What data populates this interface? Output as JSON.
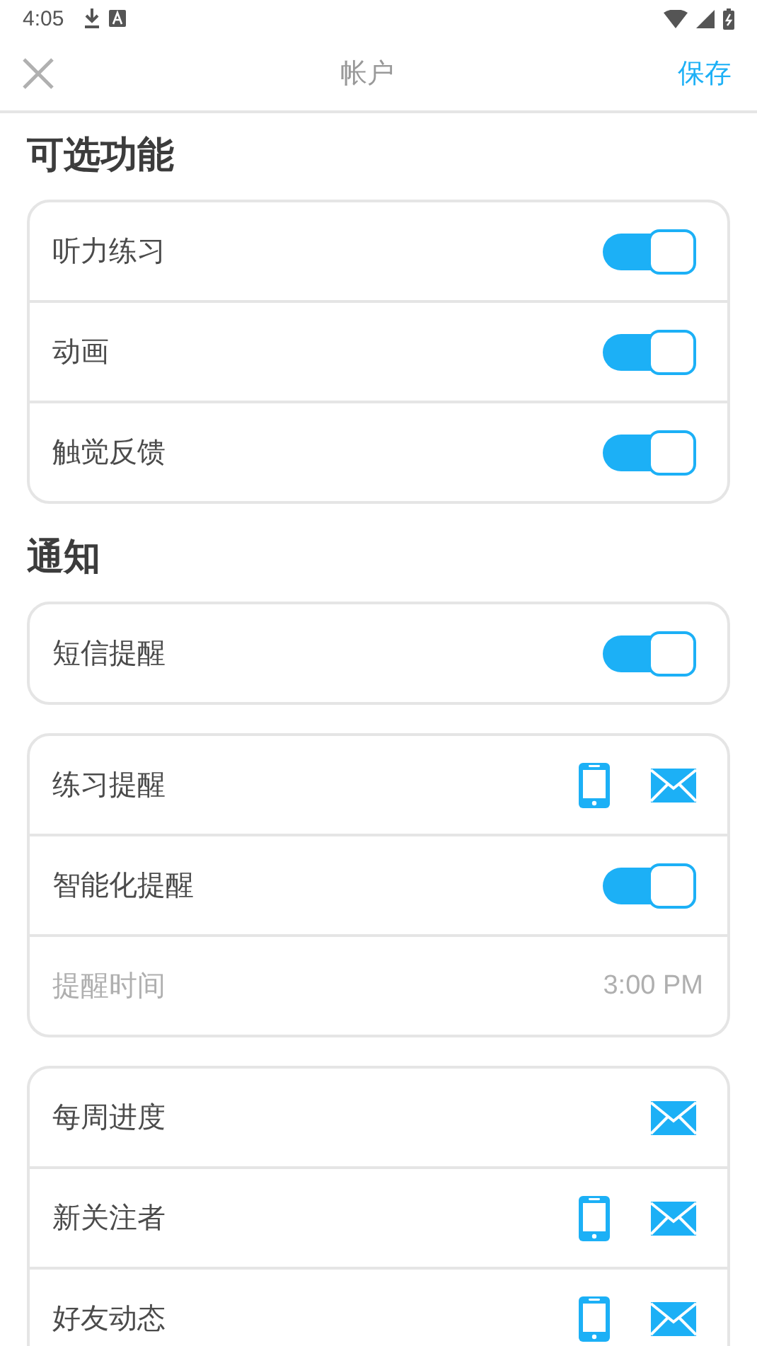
{
  "status_bar": {
    "time": "4:05"
  },
  "nav": {
    "title": "帐户",
    "action": "保存"
  },
  "sections": [
    {
      "title": "可选功能",
      "cards": [
        [
          {
            "kind": "toggle",
            "label": "听力练习",
            "on": true
          },
          {
            "kind": "toggle",
            "label": "动画",
            "on": true
          },
          {
            "kind": "toggle",
            "label": "触觉反馈",
            "on": true
          }
        ]
      ]
    },
    {
      "title": "通知",
      "cards": [
        [
          {
            "kind": "toggle",
            "label": "短信提醒",
            "on": true
          }
        ],
        [
          {
            "kind": "channels",
            "label": "练习提醒",
            "phone": true,
            "mail": true
          },
          {
            "kind": "toggle",
            "label": "智能化提醒",
            "on": true
          },
          {
            "kind": "time",
            "label": "提醒时间",
            "value": "3:00 PM"
          }
        ],
        [
          {
            "kind": "channels",
            "label": "每周进度",
            "mail": true
          },
          {
            "kind": "channels",
            "label": "新关注者",
            "phone": true,
            "mail": true
          },
          {
            "kind": "channels",
            "label": "好友动态",
            "phone": true,
            "mail": true
          }
        ]
      ]
    }
  ]
}
